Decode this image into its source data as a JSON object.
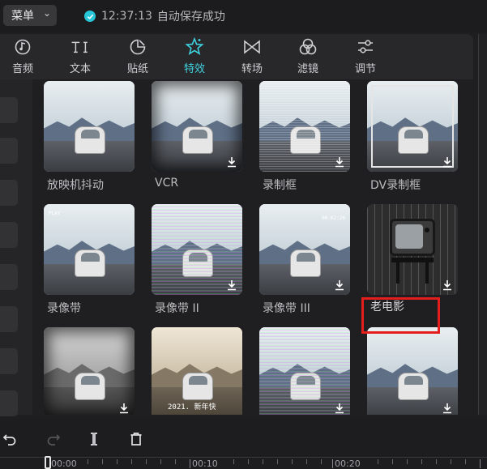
{
  "header": {
    "menu_label": "菜单",
    "save_time": "12:37:13",
    "save_text": "自动保存成功"
  },
  "tabs": [
    {
      "label": "音频",
      "icon": "audio-icon",
      "active": false
    },
    {
      "label": "文本",
      "icon": "text-icon",
      "active": false
    },
    {
      "label": "贴纸",
      "icon": "sticker-icon",
      "active": false
    },
    {
      "label": "特效",
      "icon": "effects-star-icon",
      "active": true
    },
    {
      "label": "转场",
      "icon": "transition-icon",
      "active": false
    },
    {
      "label": "滤镜",
      "icon": "filter-icon",
      "active": false
    },
    {
      "label": "调节",
      "icon": "adjust-icon",
      "active": false
    }
  ],
  "effects": [
    {
      "name": "放映机抖动"
    },
    {
      "name": "VCR"
    },
    {
      "name": "录制框"
    },
    {
      "name": "DV录制框"
    },
    {
      "name": "录像带"
    },
    {
      "name": "录像带 II"
    },
    {
      "name": "录像带 III"
    },
    {
      "name": "老电影"
    },
    {
      "name": ""
    },
    {
      "name": ""
    },
    {
      "name": ""
    },
    {
      "name": ""
    }
  ],
  "overlays": {
    "card5_text": "PLAY",
    "card7_time": "00:02:20",
    "card10_text": "2021. 新年快"
  },
  "timeline": {
    "labels": [
      "00:00",
      "00:10",
      "00:20"
    ]
  },
  "colors": {
    "accent": "#3fd3e0",
    "highlight": "#e41d1d"
  }
}
